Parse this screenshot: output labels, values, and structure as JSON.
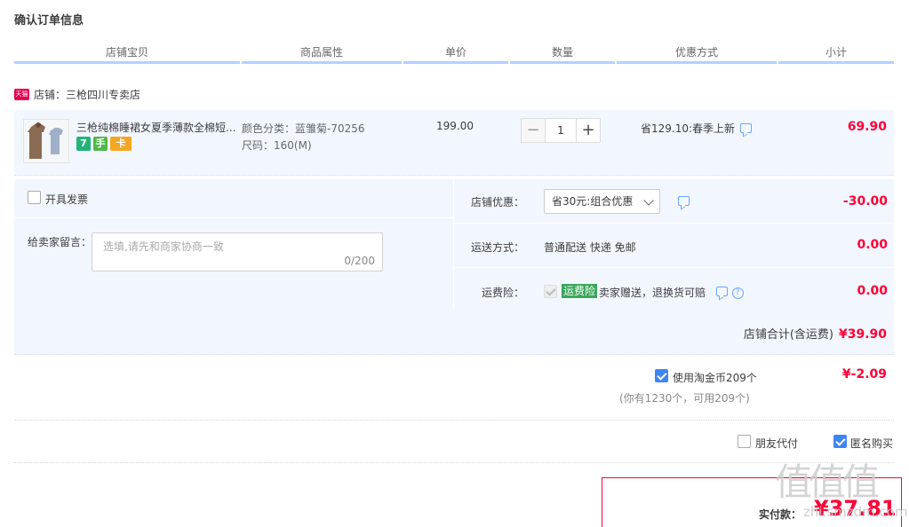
{
  "page": {
    "title": "确认订单信息"
  },
  "columns": [
    "店铺宝贝",
    "商品属性",
    "单价",
    "数量",
    "优惠方式",
    "小计"
  ],
  "shop": {
    "badge": "天猫",
    "label": "店铺：三枪四川专卖店"
  },
  "item": {
    "title": "三枪纯棉睡裙女夏季薄款全棉短...",
    "attr_color": "颜色分类：蓝雏菊-70256",
    "attr_size": "尺码：160(M)",
    "price": "199.00",
    "qty_minus": "−",
    "qty": "1",
    "qty_plus": "+",
    "promo": "省129.10:春季上新",
    "subtotal": "69.90",
    "badges": {
      "seven": "7",
      "hand": "手",
      "card": "卡"
    }
  },
  "invoice": {
    "label": "开具发票"
  },
  "memo": {
    "label": "给卖家留言：",
    "placeholder": "选填,请先和商家协商一致",
    "count": "0/200"
  },
  "shop_discount": {
    "label": "店铺优惠：",
    "selected": "省30元:组合优惠",
    "amount": "-30.00"
  },
  "delivery": {
    "label": "运送方式：",
    "text": "普通配送 快递 免邮",
    "amount": "0.00"
  },
  "insurance": {
    "label": "运费险：",
    "tag": "运费险",
    "text": "卖家赠送，退换货可赔",
    "help": "?",
    "amount": "0.00"
  },
  "shop_total": {
    "label": "店铺合计(含运费)",
    "amount": "¥39.90"
  },
  "coins": {
    "label": "使用淘金币209个",
    "note": "(你有1230个，可用209个)",
    "amount": "¥-2.09"
  },
  "pay_options": {
    "friend_pay": "朋友代付",
    "anonymous": "匿名购买"
  },
  "total": {
    "label": "实付款：",
    "amount": "¥37.81"
  },
  "watermark": {
    "text": "值值值",
    "sub": "zhi.smzdm.com"
  },
  "colors": {
    "accent_red": "#ff0036",
    "accent_blue": "#3f86f5",
    "header_line": "#b2d1ff",
    "panel_bg": "#f2f7ff"
  }
}
